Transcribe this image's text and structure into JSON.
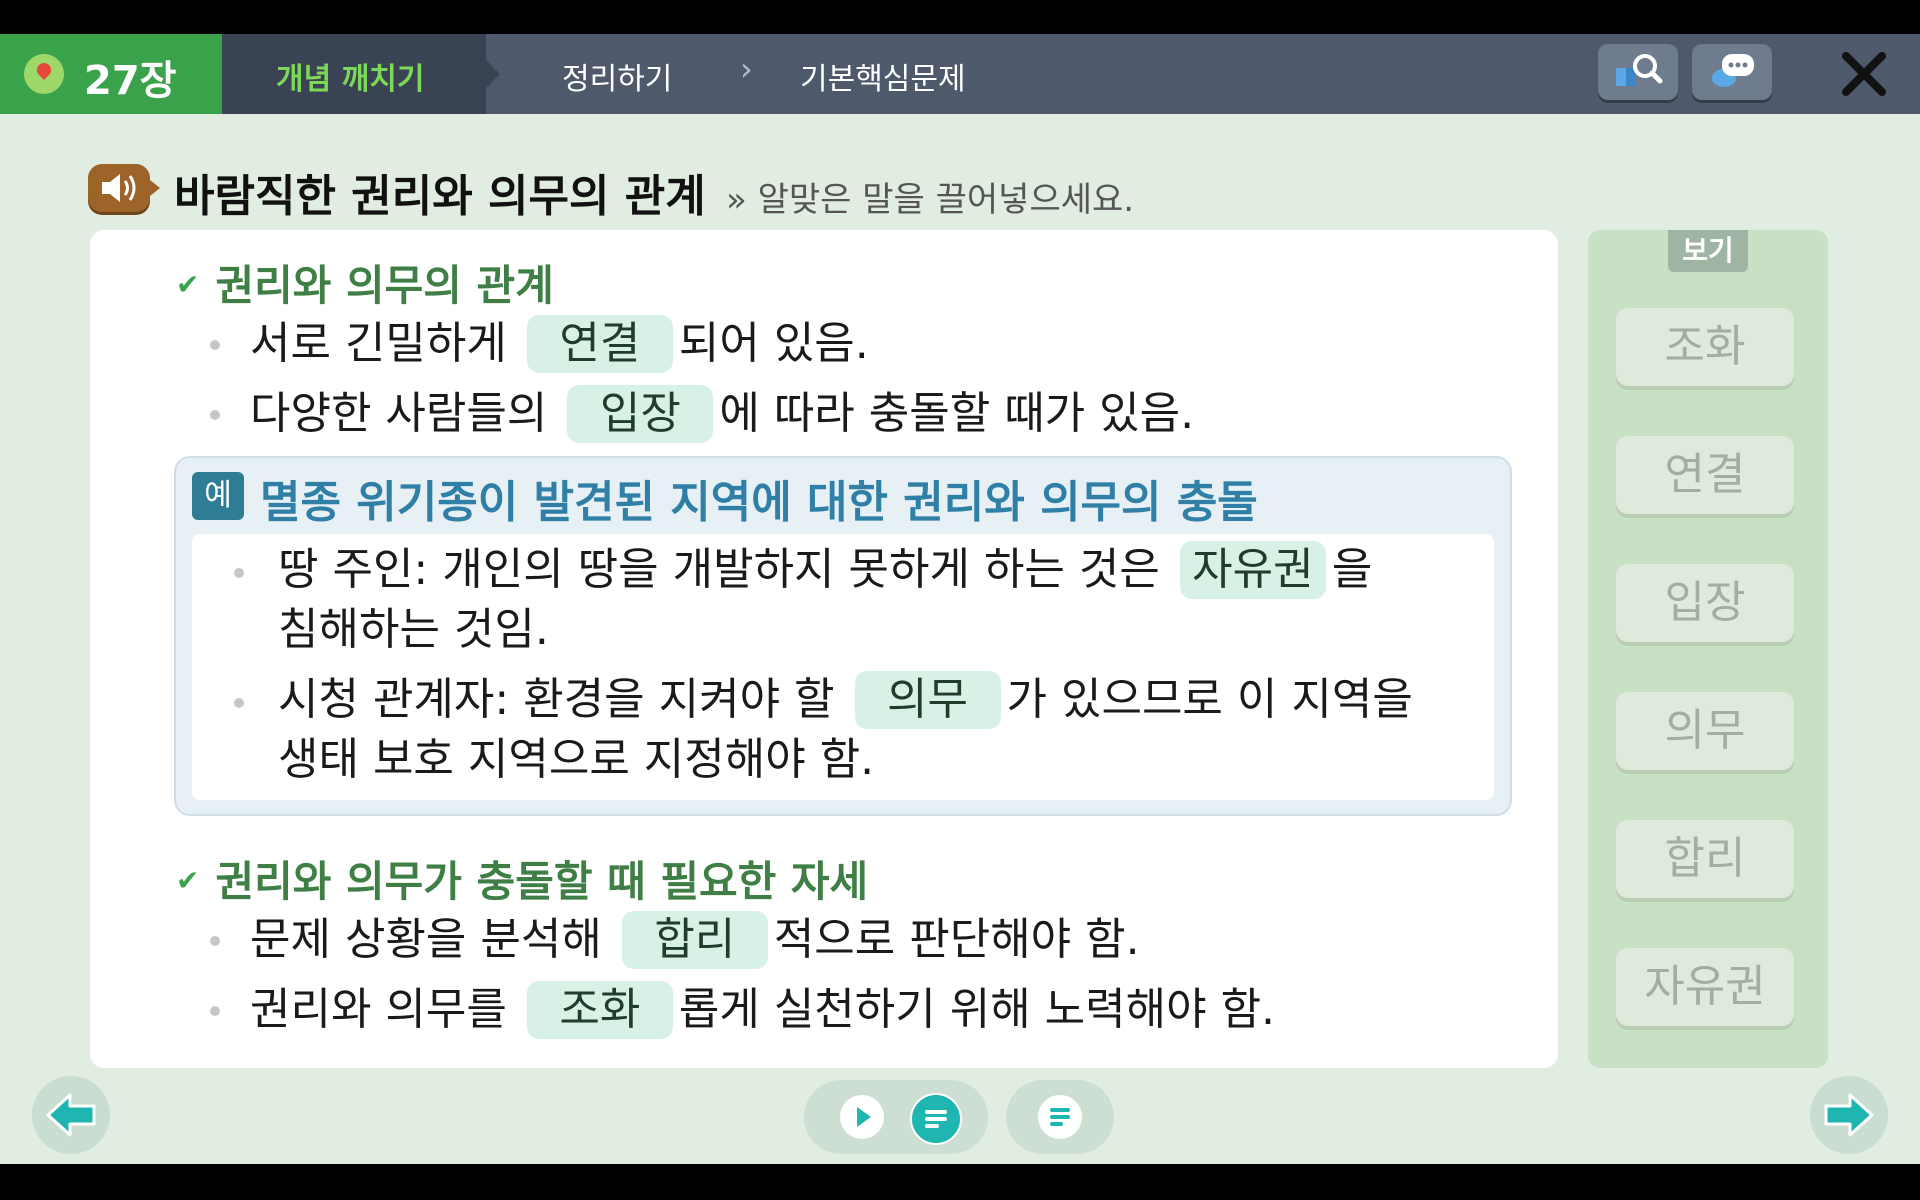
{
  "nav": {
    "chapter": "27장",
    "tab_active": "개념 깨치기",
    "tab_2": "정리하기",
    "tab_3": "기본핵심문제"
  },
  "title": "바람직한 권리와 의무의 관계",
  "instruction": "» 알맞은 말을 끌어넣으세요.",
  "section1": {
    "heading": "권리와 의무의 관계",
    "line1": {
      "before": "서로 긴밀하게",
      "blank": "연결",
      "after": "되어 있음."
    },
    "line2": {
      "before": "다양한 사람들의",
      "blank": "입장",
      "after": "에 따라 충돌할 때가 있음."
    }
  },
  "example": {
    "badge": "예",
    "title": "멸종 위기종이 발견된 지역에 대한 권리와 의무의 충돌",
    "item1": {
      "before": "땅 주인: 개인의 땅을 개발하지 못하게 하는 것은",
      "blank": "자유권",
      "after": "을",
      "line2": "침해하는 것임."
    },
    "item2": {
      "before": "시청 관계자: 환경을 지켜야 할",
      "blank": "의무",
      "after": "가 있으므로 이 지역을",
      "line2": "생태 보호 지역으로 지정해야 함."
    }
  },
  "section2": {
    "heading": "권리와 의무가 충돌할 때 필요한 자세",
    "line1": {
      "before": "문제 상황을 분석해",
      "blank": "합리",
      "after": "적으로 판단해야 함."
    },
    "line2": {
      "before": "권리와 의무를",
      "blank": "조화",
      "after": "롭게 실천하기 위해 노력해야 함."
    }
  },
  "word_bank": {
    "label": "보기",
    "words": [
      "조화",
      "연결",
      "입장",
      "의무",
      "합리",
      "자유권"
    ]
  },
  "colors": {
    "green_accent": "#3aa24a",
    "blank_fill": "#d8f1e6",
    "example_title": "#2f7fa6",
    "teal_button": "#1fb6b1"
  }
}
